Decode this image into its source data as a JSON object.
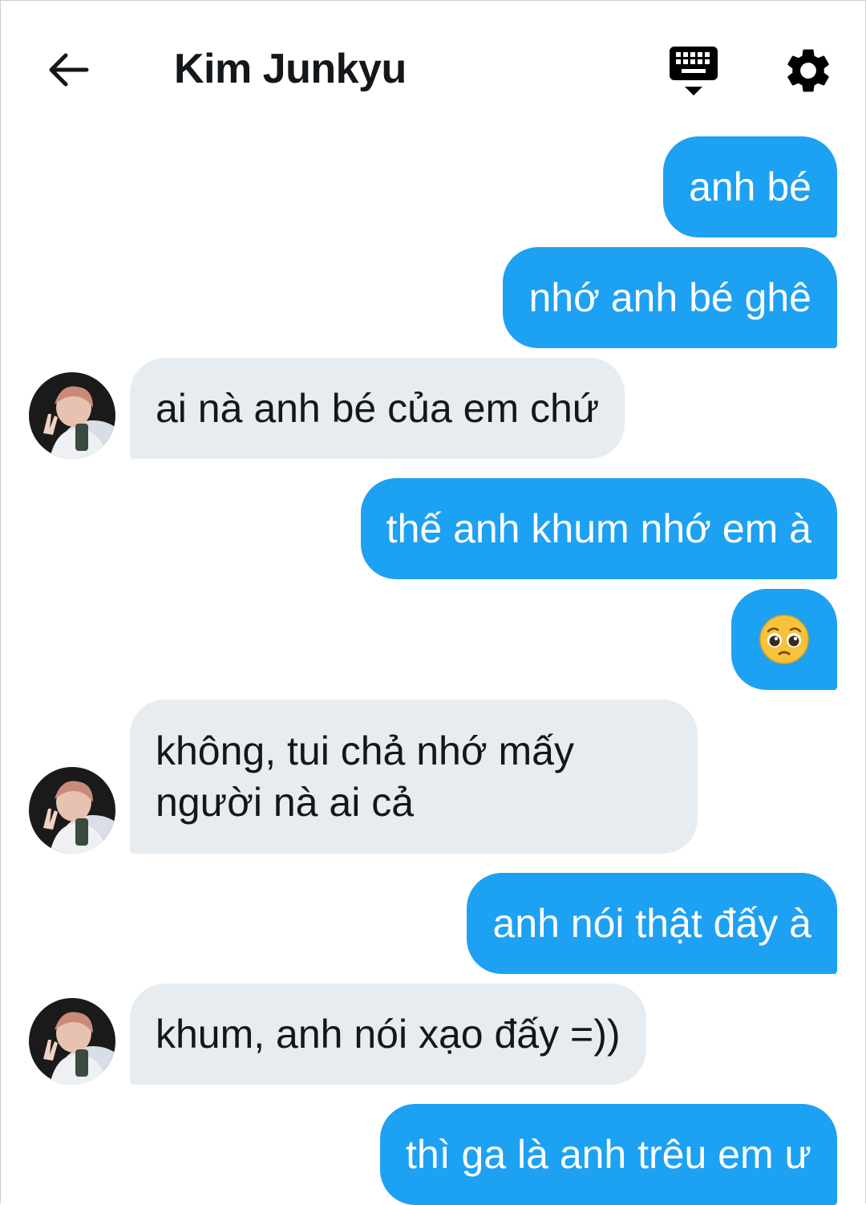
{
  "header": {
    "title": "Kim Junkyu"
  },
  "colors": {
    "sent_bubble": "#1da1f2",
    "received_bubble": "#e6ecf0",
    "text_dark": "#14171a"
  },
  "icons": {
    "back": "arrow-left-icon",
    "keyboard": "keyboard-icon",
    "settings": "gear-icon",
    "emoji": "pleading-face-emoji"
  },
  "messages": [
    {
      "direction": "sent",
      "text": "anh bé"
    },
    {
      "direction": "sent",
      "text": "nhớ anh bé ghê"
    },
    {
      "direction": "received",
      "text": "ai nà anh bé của em chứ"
    },
    {
      "direction": "sent",
      "text": "thế anh khum nhớ em à"
    },
    {
      "direction": "sent",
      "text": "🥺"
    },
    {
      "direction": "received",
      "text": "không, tui chả nhớ mấy người nà ai cả"
    },
    {
      "direction": "sent",
      "text": "anh nói thật đấy à"
    },
    {
      "direction": "received",
      "text": "khum, anh nói xạo đấy =))"
    },
    {
      "direction": "sent",
      "text": "thì ga là anh trêu em ư"
    }
  ]
}
